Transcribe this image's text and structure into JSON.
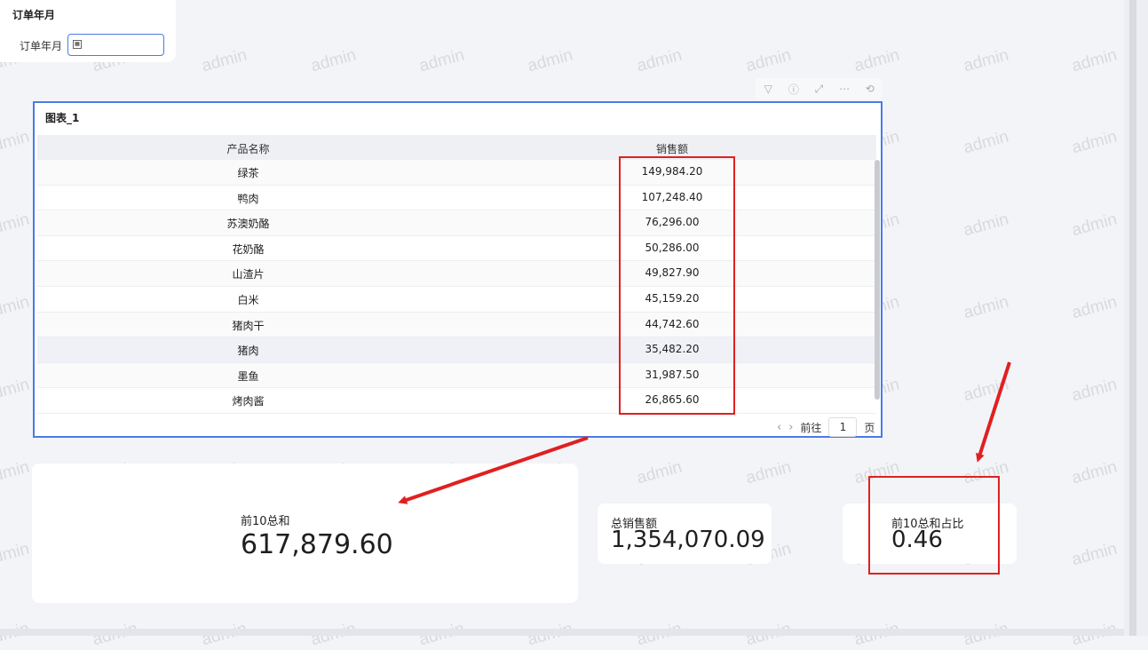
{
  "filter": {
    "title": "订单年月",
    "label": "订单年月",
    "value": ""
  },
  "chart": {
    "title": "图表_1",
    "toolbar_icons": [
      "filter-icon",
      "info-icon",
      "expand-icon",
      "more-icon",
      "refresh-icon"
    ],
    "columns": [
      "产品名称",
      "销售额"
    ],
    "rows": [
      {
        "name": "绿茶",
        "sales": "149,984.20"
      },
      {
        "name": "鸭肉",
        "sales": "107,248.40"
      },
      {
        "name": "苏澳奶酪",
        "sales": "76,296.00"
      },
      {
        "name": "花奶酪",
        "sales": "50,286.00"
      },
      {
        "name": "山渣片",
        "sales": "49,827.90"
      },
      {
        "name": "白米",
        "sales": "45,159.20"
      },
      {
        "name": "猪肉干",
        "sales": "44,742.60"
      },
      {
        "name": "猪肉",
        "sales": "35,482.20"
      },
      {
        "name": "墨鱼",
        "sales": "31,987.50"
      },
      {
        "name": "烤肉酱",
        "sales": "26,865.60"
      }
    ],
    "pager": {
      "goto_label": "前往",
      "page": "1",
      "page_suffix": "页"
    }
  },
  "kpis": {
    "top10_sum": {
      "label": "前10总和",
      "value": "617,879.60"
    },
    "total_sales": {
      "label": "总销售额",
      "value": "1,354,070.09"
    },
    "top10_ratio": {
      "label": "前10总和占比",
      "value": "0.46"
    }
  },
  "watermark": "admin",
  "colors": {
    "accent": "#4a7be8",
    "annotation": "#e02020"
  }
}
